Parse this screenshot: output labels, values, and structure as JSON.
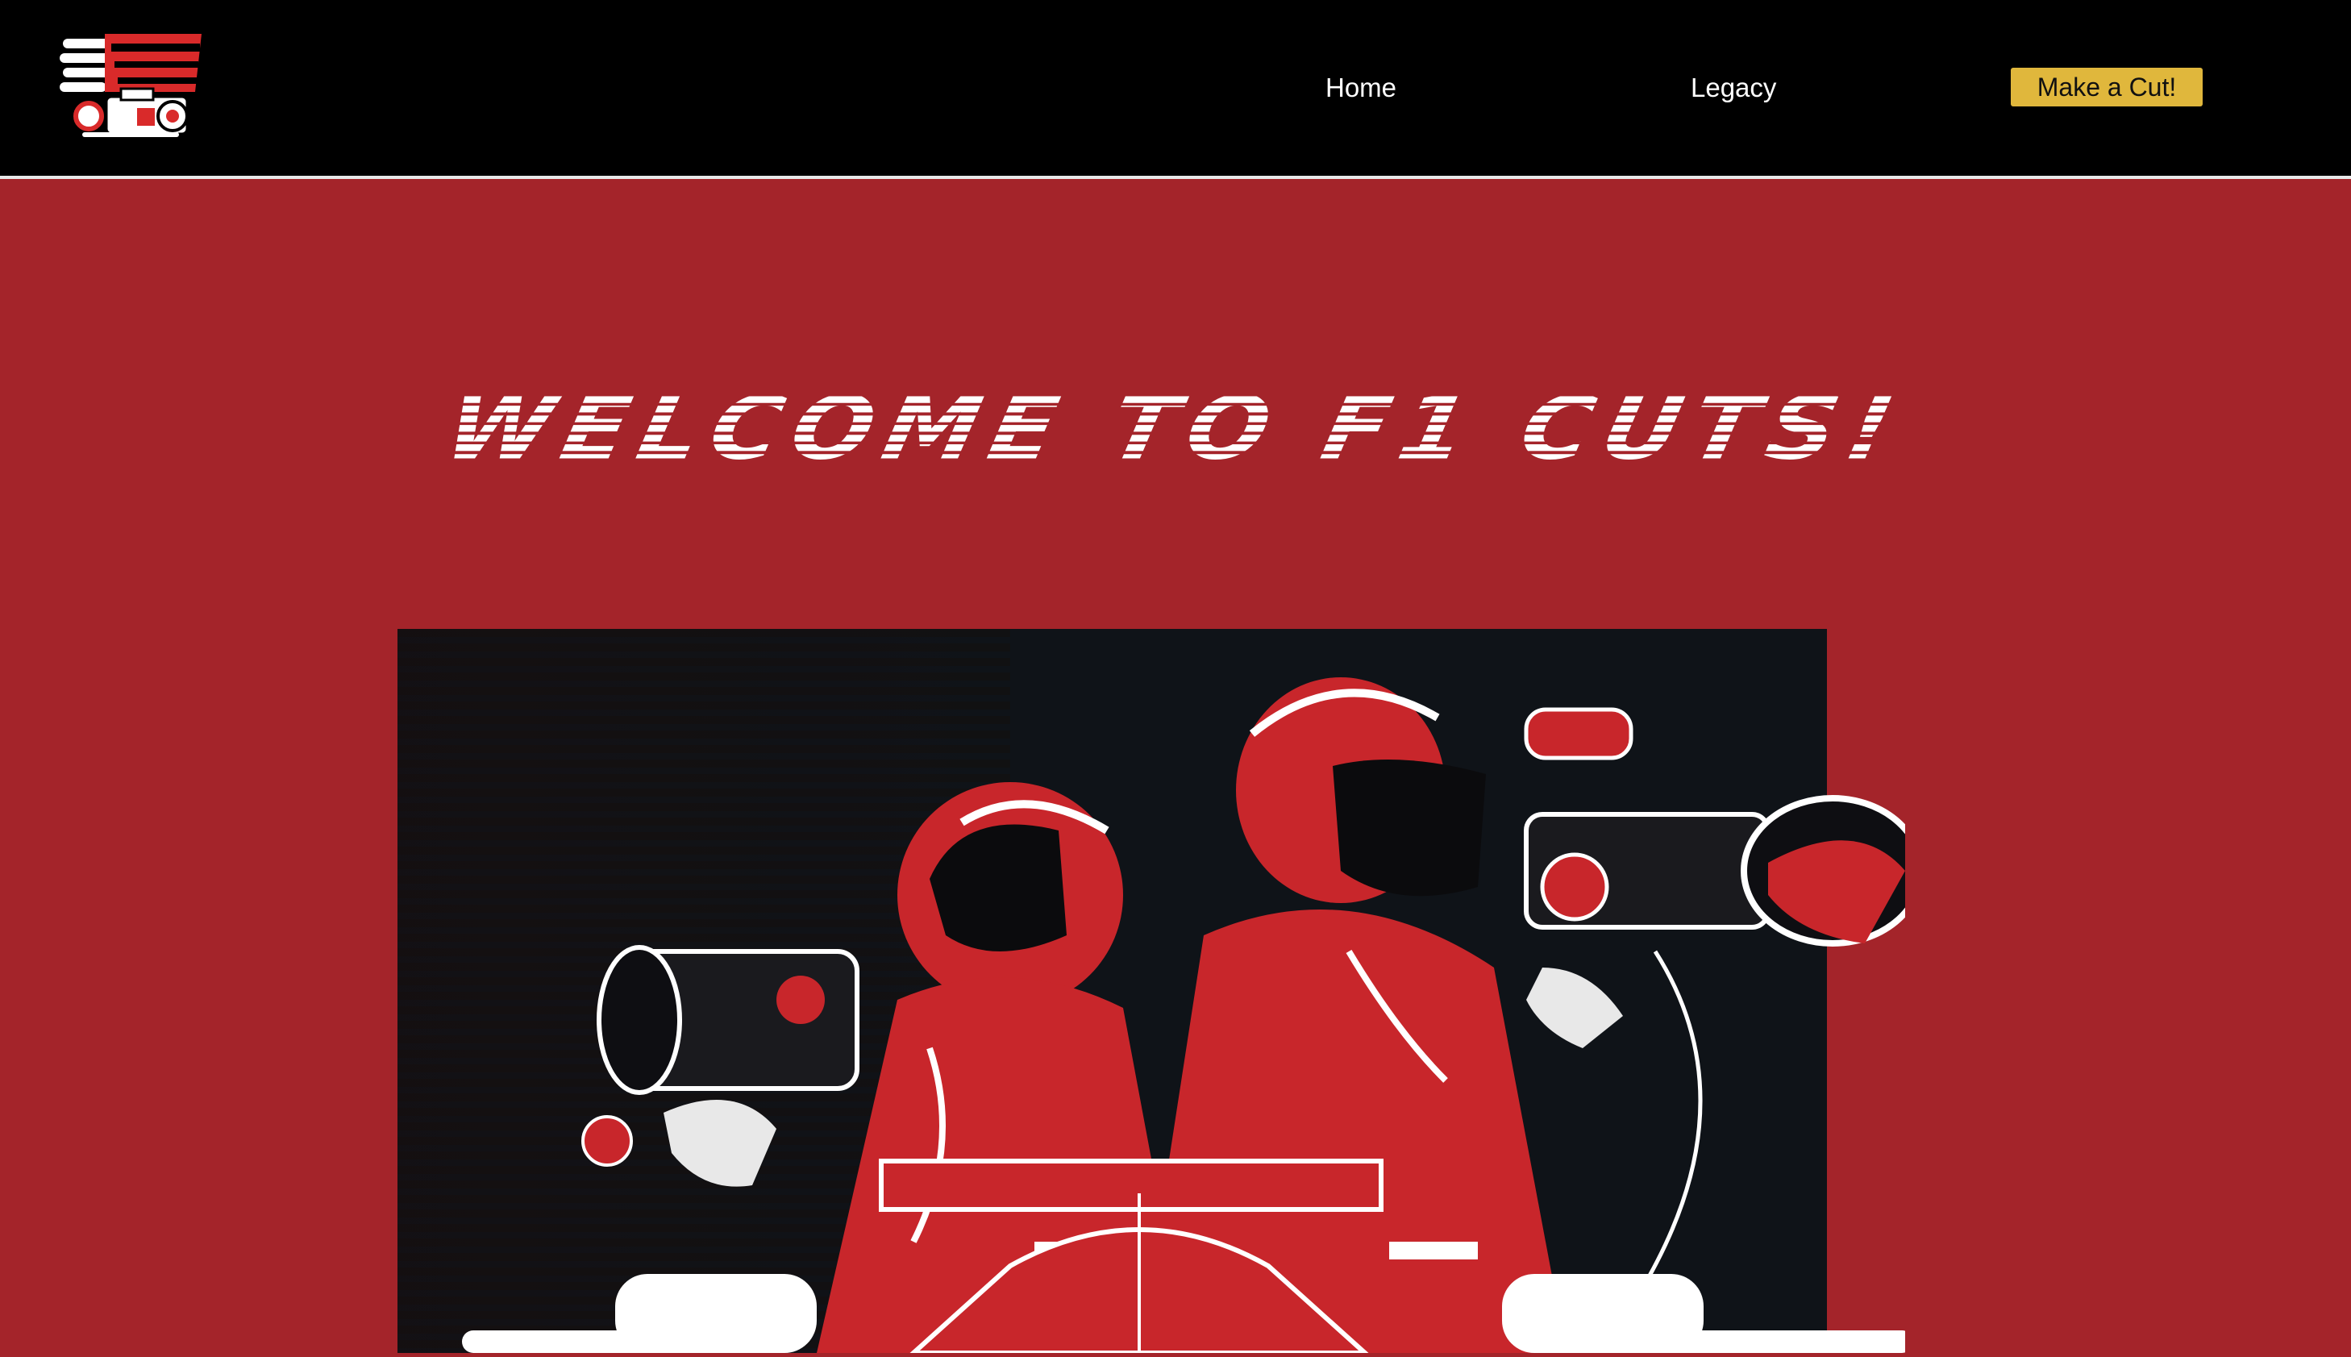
{
  "header": {
    "logo_icon": "f1-camera-logo-icon",
    "nav": {
      "home_label": "Home",
      "legacy_label": "Legacy",
      "cta_label": "Make a Cut!"
    }
  },
  "hero": {
    "title": "Welcome to F1 Cuts!",
    "image_icon": "camera-operators-race-car-illustration"
  },
  "colors": {
    "background": "#a4242a",
    "navbar": "#000000",
    "accent": "#e0b73c",
    "text": "#ffffff"
  }
}
